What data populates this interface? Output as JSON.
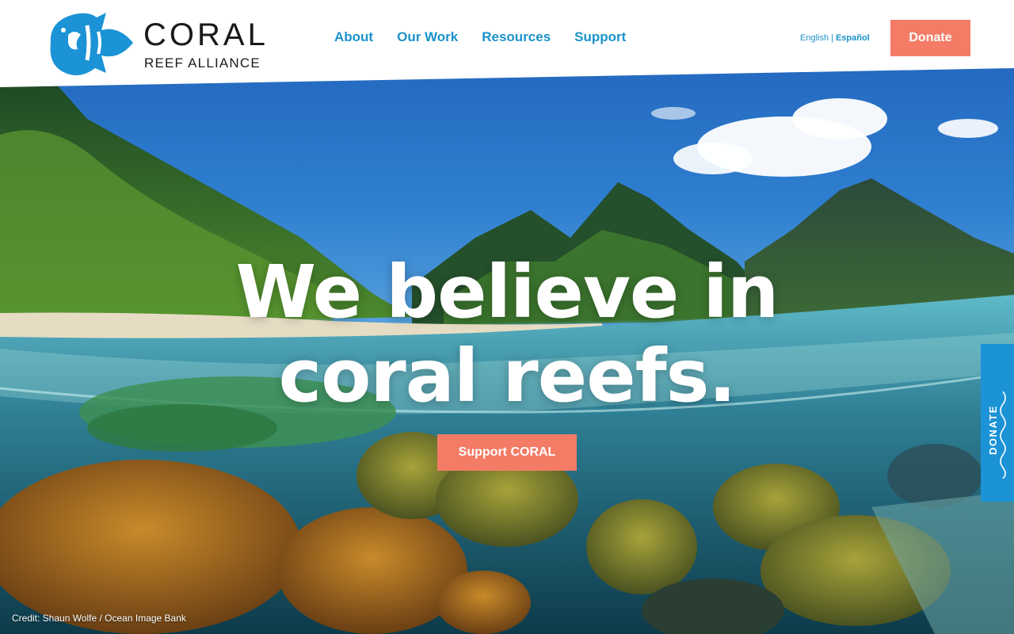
{
  "brand": {
    "line1": "CORAL",
    "line2": "REEF ALLIANCE",
    "logo_icon": "fish-logo-icon",
    "color_primary": "#1b93c9",
    "color_accent": "#f47c66"
  },
  "nav": {
    "items": [
      {
        "label": "About"
      },
      {
        "label": "Our Work"
      },
      {
        "label": "Resources"
      },
      {
        "label": "Support"
      }
    ]
  },
  "language": {
    "english": "English",
    "separator": "|",
    "spanish": "Español"
  },
  "header": {
    "donate_label": "Donate"
  },
  "hero": {
    "headline_line1": "We believe in",
    "headline_line2": "coral reefs.",
    "cta_label": "Support CORAL",
    "image_credit": "Credit: Shaun Wolfe / Ocean Image Bank"
  },
  "side_tab": {
    "label": "DONATE",
    "icon": "wave-icon"
  }
}
